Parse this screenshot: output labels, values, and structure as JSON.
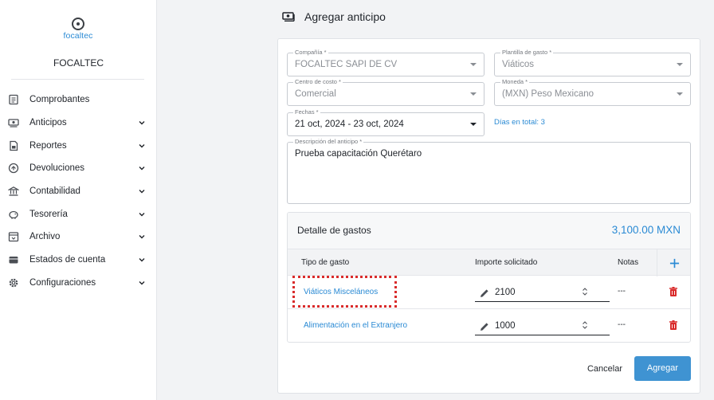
{
  "brand": {
    "logo_text": "focaltec",
    "company": "FOCALTEC"
  },
  "sidebar": {
    "items": [
      {
        "label": "Comprobantes",
        "icon": "receipt-icon",
        "chevron": false
      },
      {
        "label": "Anticipos",
        "icon": "money-icon",
        "chevron": true
      },
      {
        "label": "Reportes",
        "icon": "report-icon",
        "chevron": true
      },
      {
        "label": "Devoluciones",
        "icon": "refund-icon",
        "chevron": true
      },
      {
        "label": "Contabilidad",
        "icon": "bank-icon",
        "chevron": true
      },
      {
        "label": "Tesorería",
        "icon": "piggy-bank-icon",
        "chevron": true
      },
      {
        "label": "Archivo",
        "icon": "archive-icon",
        "chevron": true
      },
      {
        "label": "Estados de cuenta",
        "icon": "wallet-icon",
        "chevron": true
      },
      {
        "label": "Configuraciones",
        "icon": "gear-icon",
        "chevron": true
      }
    ]
  },
  "page": {
    "title": "Agregar anticipo",
    "title_icon": "money-icon"
  },
  "form": {
    "compania": {
      "label": "Compañía *",
      "value": "FOCALTEC SAPI DE CV"
    },
    "plantilla": {
      "label": "Plantilla de gasto *",
      "value": "Viáticos"
    },
    "centro": {
      "label": "Centro de costo *",
      "value": "Comercial"
    },
    "moneda": {
      "label": "Moneda *",
      "value": "(MXN) Peso Mexicano"
    },
    "fechas": {
      "label": "Fechas *",
      "value": "21 oct, 2024 - 23 oct, 2024"
    },
    "dias": "Días en total: 3",
    "descripcion": {
      "label": "Descripción del anticipo *",
      "value": "Prueba capacitación Querétaro"
    }
  },
  "detalle": {
    "title": "Detalle de gastos",
    "total": "3,100.00 MXN",
    "columns": {
      "tipo": "Tipo de gasto",
      "importe": "Importe solicitado",
      "notas": "Notas"
    },
    "rows": [
      {
        "tipo": "Viáticos Misceláneos",
        "importe": "2100",
        "notas": "---"
      },
      {
        "tipo": "Alimentación en el Extranjero",
        "importe": "1000",
        "notas": "---"
      }
    ]
  },
  "actions": {
    "cancel": "Cancelar",
    "submit": "Agregar"
  },
  "colors": {
    "accent": "#2a8ad4",
    "primary_button": "#3f93d2",
    "danger": "#d92b2b",
    "highlight": "#d92b2b"
  }
}
